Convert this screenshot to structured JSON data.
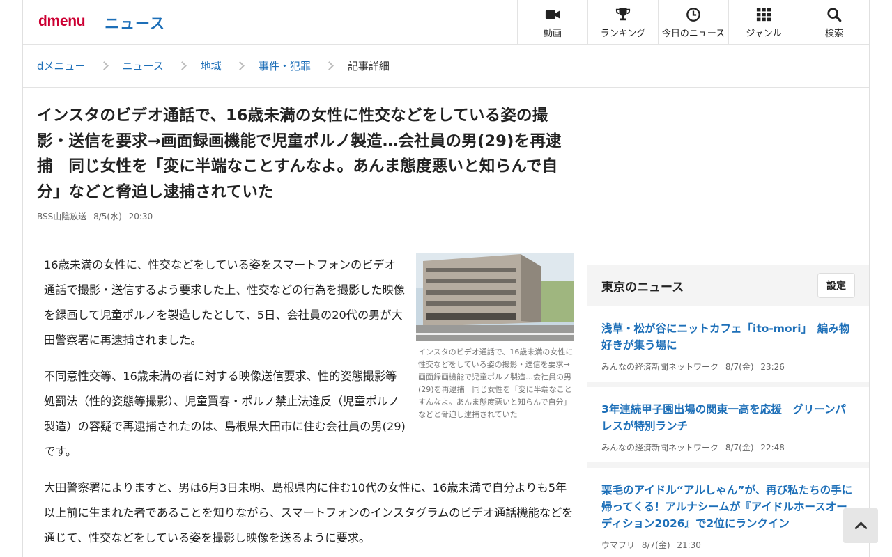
{
  "header": {
    "logo_d": "d",
    "logo_rest": "menu",
    "section_title": "ニュース",
    "nav": [
      {
        "label": "動画",
        "icon": "video-icon"
      },
      {
        "label": "ランキング",
        "icon": "trophy-icon"
      },
      {
        "label": "今日のニュース",
        "icon": "clock-icon"
      },
      {
        "label": "ジャンル",
        "icon": "grid-icon"
      },
      {
        "label": "検索",
        "icon": "search-icon"
      }
    ]
  },
  "breadcrumb": [
    "dメニュー",
    "ニュース",
    "地域",
    "事件・犯罪",
    "記事詳細"
  ],
  "article": {
    "headline": "インスタのビデオ通話で、16歳未満の女性に性交などをしている姿の撮影・送信を要求→画面録画機能で児童ポルノ製造…会社員の男(29)を再逮捕　同じ女性を「変に半端なことすんなよ。あんま態度悪いと知らんで自分」などと脅迫し逮捕されていた",
    "source": "BSS山陰放送",
    "date": "8/5(水)",
    "time": "20:30",
    "paragraphs": [
      "16歳未満の女性に、性交などをしている姿をスマートフォンのビデオ通話で撮影・送信するよう要求した上、性交などの行為を撮影した映像を録画して児童ポルノを製造したとして、5日、会社員の20代の男が大田警察署に再逮捕されました。",
      "不同意性交等、16歳未満の者に対する映像送信要求、性的姿態撮影等処罰法（性的姿態等撮影）、児童買春・ポルノ禁止法違反（児童ポルノ製造）の容疑で再逮捕されたのは、島根県大田市に住む会社員の男(29)です。",
      "大田警察署によりますと、男は6月3日未明、島根県内に住む10代の女性に、16歳未満で自分よりも5年以上前に生まれた者であることを知りながら、スマートフォンのインスタグラムのビデオ通話機能などを通じて、性交などをしている姿を撮影し映像を送るように要求。"
    ],
    "photo_caption": "インスタのビデオ通話で、16歳未満の女性に性交などをしている姿の撮影・送信を要求→画面録画機能で児童ポルノ製造…会社員の男(29)を再逮捕　同じ女性を「変に半端なことすんなよ。あんま態度悪いと知らんで自分」などと脅迫し逮捕されていた"
  },
  "sidebar": {
    "title": "東京のニュース",
    "settings_label": "設定",
    "news": [
      {
        "title": "浅草・松が谷にニットカフェ「ito-mori」　編み物好きが集う場に",
        "source": "みんなの経済新聞ネットワーク",
        "date": "8/7(金)",
        "time": "23:26"
      },
      {
        "title": "3年連続甲子園出場の関東一高を応援　グリーンパレスが特別ランチ",
        "source": "みんなの経済新聞ネットワーク",
        "date": "8/7(金)",
        "time": "22:48"
      },
      {
        "title": "栗毛のアイドル“アルしゃん”が、再び私たちの手に帰ってくる！アルナシームが『アイドルホースオーディション2026』で2位にランクイン",
        "source": "ウマフリ",
        "date": "8/7(金)",
        "time": "21:30"
      }
    ]
  },
  "colors": {
    "brand": "#cc0033",
    "link": "#1d6fb8"
  }
}
